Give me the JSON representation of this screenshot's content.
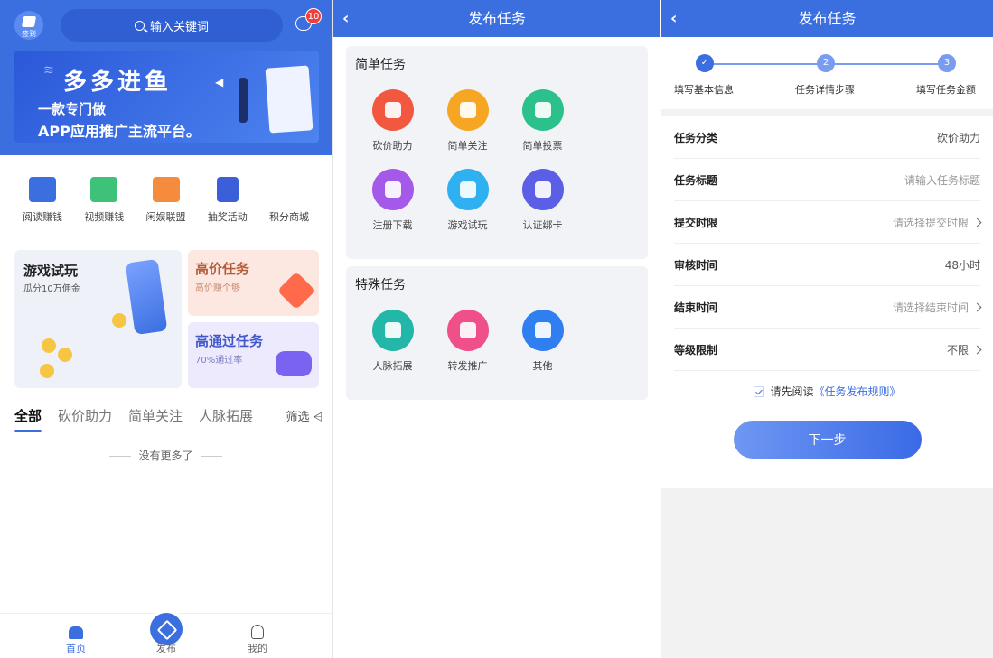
{
  "home": {
    "checkin_label": "签到",
    "search_placeholder": "输入关键词",
    "message_badge": "10",
    "banner": {
      "title": "多多进鱼",
      "line1": "一款专门做",
      "line2": "APP应用推广主流平台。"
    },
    "grid": [
      {
        "label": "阅读赚钱",
        "icon": "book-star-icon",
        "color": "#3b6fe0"
      },
      {
        "label": "视频赚钱",
        "icon": "video-icon",
        "color": "#3ec27a"
      },
      {
        "label": "闲娱联盟",
        "icon": "gamepad-icon",
        "color": "#f58b3c"
      },
      {
        "label": "抽奖活动",
        "icon": "flag-icon",
        "color": "#3b5fd8"
      },
      {
        "label": "积分商城",
        "icon": "shop-icon",
        "color": "#ffffff"
      }
    ],
    "cards": {
      "big": {
        "title": "游戏试玩",
        "subtitle": "瓜分10万佣金"
      },
      "high_price": {
        "title": "高价任务",
        "subtitle": "高价赚个够"
      },
      "high_pass": {
        "title": "高通过任务",
        "subtitle": "70%通过率"
      }
    },
    "tabs": [
      "全部",
      "砍价助力",
      "简单关注",
      "人脉拓展"
    ],
    "filter_label": "筛选",
    "no_more": "没有更多了",
    "tabbar": {
      "home": "首页",
      "publish": "发布",
      "me": "我的"
    }
  },
  "publish": {
    "nav_title": "发布任务",
    "simple": {
      "title": "简单任务",
      "items": [
        {
          "label": "砍价助力",
          "icon": "bargain-tag-icon",
          "color": "#f2573f"
        },
        {
          "label": "简单关注",
          "icon": "heart-plus-icon",
          "color": "#f6a623"
        },
        {
          "label": "简单投票",
          "icon": "vote-box-icon",
          "color": "#2cc08a"
        },
        {
          "label": "注册下载",
          "icon": "download-icon",
          "color": "#a559e8"
        },
        {
          "label": "游戏试玩",
          "icon": "gamepad-icon",
          "color": "#2fb0f0"
        },
        {
          "label": "认证绑卡",
          "icon": "card-link-icon",
          "color": "#5a5fe6"
        }
      ]
    },
    "special": {
      "title": "特殊任务",
      "items": [
        {
          "label": "人脉拓展",
          "icon": "people-icon",
          "color": "#22b7a8"
        },
        {
          "label": "转发推广",
          "icon": "share-icon",
          "color": "#f0508a"
        },
        {
          "label": "其他",
          "icon": "four-leaf-icon",
          "color": "#2f7ff0"
        }
      ]
    }
  },
  "form": {
    "nav_title": "发布任务",
    "steps": [
      {
        "num": "✓",
        "label": "填写基本信息"
      },
      {
        "num": "2",
        "label": "任务详情步骤"
      },
      {
        "num": "3",
        "label": "填写任务金额"
      }
    ],
    "rows": [
      {
        "label": "任务分类",
        "value": "砍价助力",
        "placeholder": false,
        "chevron": false
      },
      {
        "label": "任务标题",
        "value": "请输入任务标题",
        "placeholder": true,
        "chevron": false
      },
      {
        "label": "提交时限",
        "value": "请选择提交时限",
        "placeholder": true,
        "chevron": true
      },
      {
        "label": "审核时间",
        "value": "48小时",
        "placeholder": false,
        "chevron": false
      },
      {
        "label": "结束时间",
        "value": "请选择结束时间",
        "placeholder": true,
        "chevron": true
      },
      {
        "label": "等级限制",
        "value": "不限",
        "placeholder": false,
        "chevron": true
      }
    ],
    "agree_prefix": "请先阅读",
    "agree_link": "《任务发布规则》",
    "next_label": "下一步"
  },
  "colors": {
    "primary": "#3b6fe0",
    "badge": "#f23d3d"
  }
}
